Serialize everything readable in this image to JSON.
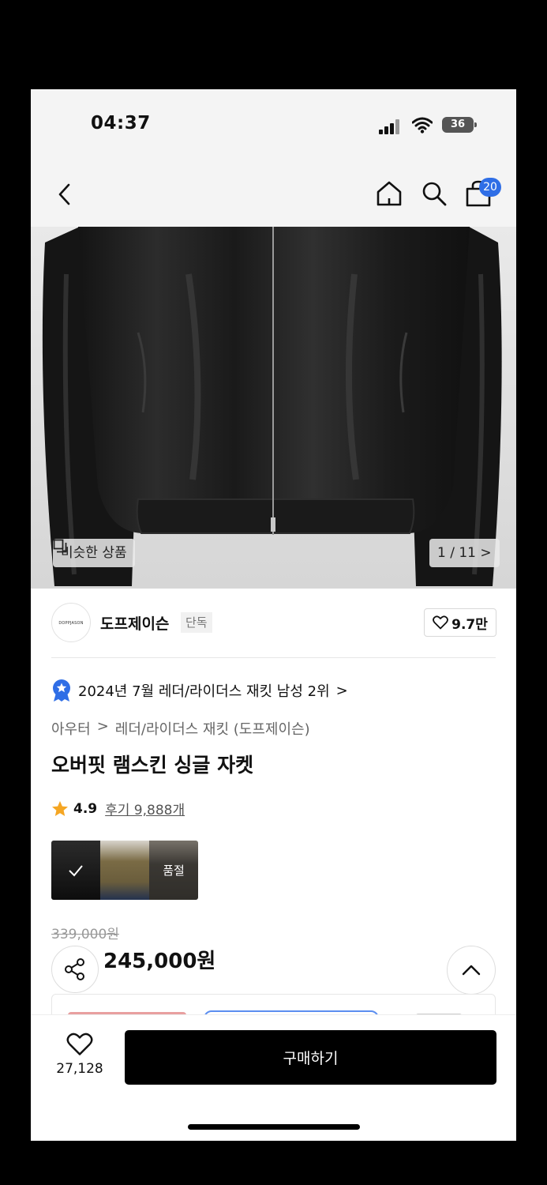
{
  "status_bar": {
    "time": "04:37",
    "battery": "36"
  },
  "nav": {
    "cart_count": "20"
  },
  "gallery": {
    "similar_label": "비슷한 상품",
    "page_indicator": "1 / 11 >"
  },
  "brand": {
    "logo_text": "DOPPJASON",
    "name": "도프제이슨",
    "badge": "단독",
    "likes": "9.7만"
  },
  "ranking": {
    "text": "2024년 7월 레더/라이더스 재킷 남성 2위",
    "chevron": ">"
  },
  "breadcrumb": {
    "category": "아우터",
    "separator": ">",
    "subcategory": "레더/라이더스 재킷 (도프제이슨)"
  },
  "product": {
    "title": "오버핏 램스킨 싱글 자켓",
    "rating": "4.9",
    "reviews": "후기 9,888개",
    "sold_out_label": "품절",
    "original_price": "339,000원",
    "sale_price": "245,000원"
  },
  "bottom_bar": {
    "wish_count": "27,128",
    "buy_label": "구매하기"
  },
  "colors": {
    "accent": "#2f6ee6",
    "sale": "#e03a3a",
    "star": "#f5a623",
    "buy_bg": "#000000"
  }
}
